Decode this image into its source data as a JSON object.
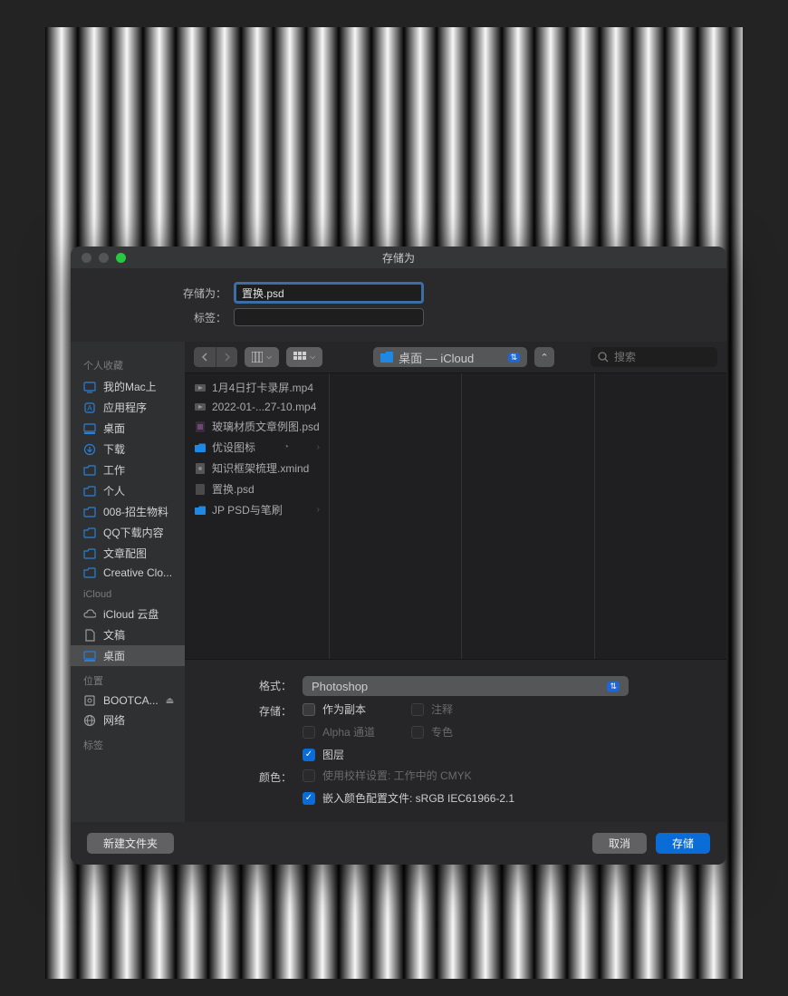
{
  "dialog_title": "存储为",
  "save_as": {
    "label": "存储为：",
    "value": "置换.psd"
  },
  "tags": {
    "label": "标签：",
    "value": ""
  },
  "location": {
    "label": "桌面 — iCloud"
  },
  "search": {
    "placeholder": "搜索"
  },
  "sidebar": {
    "sections": [
      {
        "label": "个人收藏",
        "items": [
          {
            "icon": "mac",
            "label": "我的Mac上"
          },
          {
            "icon": "app",
            "label": "应用程序"
          },
          {
            "icon": "desktop",
            "label": "桌面"
          },
          {
            "icon": "download",
            "label": "下载"
          },
          {
            "icon": "folder",
            "label": "工作"
          },
          {
            "icon": "folder",
            "label": "个人"
          },
          {
            "icon": "folder",
            "label": "008-招生物料"
          },
          {
            "icon": "folder",
            "label": "QQ下载内容"
          },
          {
            "icon": "folder",
            "label": "文章配图"
          },
          {
            "icon": "folder",
            "label": "Creative Clo..."
          }
        ]
      },
      {
        "label": "iCloud",
        "items": [
          {
            "icon": "cloud",
            "label": "iCloud 云盘"
          },
          {
            "icon": "doc",
            "label": "文稿"
          },
          {
            "icon": "desktop",
            "label": "桌面",
            "selected": true
          }
        ]
      },
      {
        "label": "位置",
        "items": [
          {
            "icon": "disk",
            "label": "BOOTCA...",
            "eject": true
          },
          {
            "icon": "network",
            "label": "网络"
          }
        ]
      },
      {
        "label": "标签",
        "items": []
      }
    ]
  },
  "files": [
    {
      "icon": "video",
      "name": "1月4日打卡录屏.mp4"
    },
    {
      "icon": "video",
      "name": "2022-01-...27-10.mp4"
    },
    {
      "icon": "psd",
      "name": "玻璃材质文章例图.psd"
    },
    {
      "icon": "folder",
      "name": "优设图标",
      "clock": true,
      "arrow": true
    },
    {
      "icon": "xmind",
      "name": "知识框架梳理.xmind"
    },
    {
      "icon": "psdg",
      "name": "置换.psd"
    },
    {
      "icon": "folder",
      "name": "JP  PSD与笔刷",
      "arrow": true
    }
  ],
  "format": {
    "label": "格式：",
    "value": "Photoshop"
  },
  "store": {
    "label": "存储：",
    "options": [
      {
        "label": "作为副本",
        "checked": false,
        "disabled": false
      },
      {
        "label": "Alpha 通道",
        "checked": false,
        "disabled": true
      },
      {
        "label": "图层",
        "checked": true,
        "disabled": false
      }
    ],
    "options_right": [
      {
        "label": "注释",
        "checked": false,
        "disabled": true
      },
      {
        "label": "专色",
        "checked": false,
        "disabled": true
      }
    ]
  },
  "color": {
    "label": "颜色：",
    "options": [
      {
        "label": "使用校样设置: 工作中的 CMYK",
        "checked": false,
        "disabled": true
      },
      {
        "label": "嵌入颜色配置文件: sRGB IEC61966-2.1",
        "checked": true,
        "disabled": false
      }
    ]
  },
  "footer": {
    "new_folder": "新建文件夹",
    "cancel": "取消",
    "save": "存储"
  }
}
